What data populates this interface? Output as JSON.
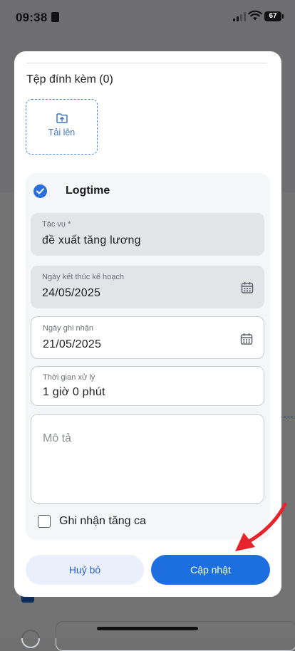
{
  "status_bar": {
    "time": "09:38",
    "battery": "67"
  },
  "attachments": {
    "title": "Tệp đính kèm (0)",
    "upload_label": "Tải lên"
  },
  "logtime": {
    "label": "Logtime",
    "checked": true
  },
  "fields": {
    "task": {
      "label": "Tác vụ *",
      "value": "đề xuất tăng lương"
    },
    "planned_end": {
      "label": "Ngày kết thúc kế hoạch",
      "value": "24/05/2025"
    },
    "recorded_date": {
      "label": "Ngày ghi nhận",
      "value": "21/05/2025"
    },
    "processing_time": {
      "label": "Thời gian xử lý",
      "value": "1 giờ 0 phút"
    },
    "description": {
      "placeholder": "Mô tả",
      "value": ""
    }
  },
  "overtime": {
    "label": "Ghi nhận tăng ca",
    "checked": false
  },
  "buttons": {
    "cancel": "Huỷ bỏ",
    "update": "Cập nhật"
  },
  "colors": {
    "primary": "#1d6fe0",
    "annotation_arrow": "#e5242b"
  },
  "icons": [
    "folder-upload-icon",
    "calendar-icon",
    "check-circle-icon",
    "checkbox-icon",
    "wifi-icon",
    "battery-icon",
    "sim-icon",
    "signal-icon"
  ]
}
